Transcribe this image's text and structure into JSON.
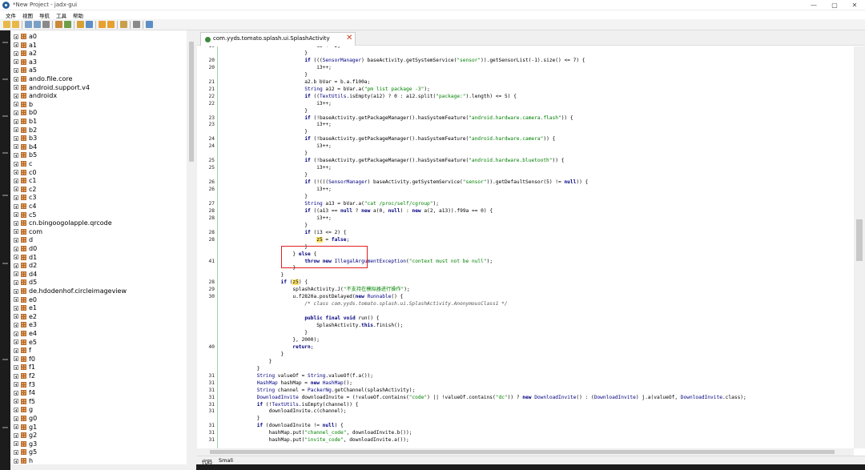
{
  "window": {
    "title": "*New Project - jadx-gui",
    "controls": {
      "minimize": "—",
      "maximize": "▢",
      "close": "✕"
    }
  },
  "menubar": [
    "文件",
    "视图",
    "导航",
    "工具",
    "帮助"
  ],
  "tree": {
    "items": [
      "a0",
      "a1",
      "a2",
      "a3",
      "a5",
      "ando.file.core",
      "android.support.v4",
      "androidx",
      "b",
      "b0",
      "b1",
      "b2",
      "b3",
      "b4",
      "b5",
      "c",
      "c0",
      "c1",
      "c2",
      "c3",
      "c4",
      "c5",
      "cn.bingoogolapple.qrcode",
      "com",
      "d",
      "d0",
      "d1",
      "d2",
      "d4",
      "d5",
      "de.hdodenhof.circleimageview",
      "e0",
      "e1",
      "e2",
      "e3",
      "e4",
      "e5",
      "f",
      "f0",
      "f1",
      "f2",
      "f3",
      "f4",
      "f5",
      "g",
      "g0",
      "g1",
      "g2",
      "g3",
      "g5",
      "h"
    ]
  },
  "editor": {
    "tab_label": "com.yyds.tomato.splash.ui.SplashActivity",
    "close_glyph": "✕",
    "bottom_tabs": [
      "代码",
      "Smali"
    ]
  },
  "code": {
    "lines": [
      {
        "n": "19",
        "t": "                                i3 += 2;"
      },
      {
        "n": "",
        "t": "                            }"
      },
      {
        "n": "20",
        "t": "                            if (((SensorManager) baseActivity.getSystemService(\"sensor\")).getSensorList(-1).size() <= 7) {"
      },
      {
        "n": "20",
        "t": "                                i3++;"
      },
      {
        "n": "",
        "t": "                            }"
      },
      {
        "n": "21",
        "t": "                            a2.b bVar = b.a.f100a;"
      },
      {
        "n": "21",
        "t": "                            String a12 = bVar.a(\"pm list package -3\");"
      },
      {
        "n": "22",
        "t": "                            if ((TextUtils.isEmpty(a12) ? 0 : a12.split(\"package:\").length) <= 5) {"
      },
      {
        "n": "22",
        "t": "                                i3++;"
      },
      {
        "n": "",
        "t": "                            }"
      },
      {
        "n": "23",
        "t": "                            if (!baseActivity.getPackageManager().hasSystemFeature(\"android.hardware.camera.flash\")) {"
      },
      {
        "n": "23",
        "t": "                                i3++;"
      },
      {
        "n": "",
        "t": "                            }"
      },
      {
        "n": "24",
        "t": "                            if (!baseActivity.getPackageManager().hasSystemFeature(\"android.hardware.camera\")) {"
      },
      {
        "n": "24",
        "t": "                                i3++;"
      },
      {
        "n": "",
        "t": "                            }"
      },
      {
        "n": "25",
        "t": "                            if (!baseActivity.getPackageManager().hasSystemFeature(\"android.hardware.bluetooth\")) {"
      },
      {
        "n": "25",
        "t": "                                i3++;"
      },
      {
        "n": "",
        "t": "                            }"
      },
      {
        "n": "26",
        "t": "                            if (!(((SensorManager) baseActivity.getSystemService(\"sensor\")).getDefaultSensor(5) != null)) {"
      },
      {
        "n": "26",
        "t": "                                i3++;"
      },
      {
        "n": "",
        "t": "                            }"
      },
      {
        "n": "27",
        "t": "                            String a13 = bVar.a(\"cat /proc/self/cgroup\");"
      },
      {
        "n": "28",
        "t": "                            if ((a13 == null ? new a(0, null) : new a(2, a13)).f99a == 0) {"
      },
      {
        "n": "28",
        "t": "                                i3++;"
      },
      {
        "n": "",
        "t": "                            }"
      },
      {
        "n": "28",
        "t": "                            if (i3 <= 2) {"
      },
      {
        "n": "28",
        "t": "                                z5 = false;"
      },
      {
        "n": "",
        "t": "                            }"
      },
      {
        "n": "",
        "t": "                        } else {"
      },
      {
        "n": "41",
        "t": "                            throw new IllegalArgumentException(\"context must not be null\");"
      },
      {
        "n": "",
        "t": "                        }"
      },
      {
        "n": "",
        "t": "                    }"
      },
      {
        "n": "28",
        "t": "                    if (z5) {"
      },
      {
        "n": "29",
        "t": "                        splashActivity.J(\"不支持在模拟器进行操作\");"
      },
      {
        "n": "30",
        "t": "                        u.f2820a.postDelayed(new Runnable() {"
      },
      {
        "n": "",
        "t": "                            /* class com.yyds.tomato.splash.ui.SplashActivity.AnonymousClass1 */"
      },
      {
        "n": "",
        "t": ""
      },
      {
        "n": "",
        "t": "                            public final void run() {"
      },
      {
        "n": "",
        "t": "                                SplashActivity.this.finish();"
      },
      {
        "n": "",
        "t": "                            }"
      },
      {
        "n": "",
        "t": "                        }, 2000);"
      },
      {
        "n": "40",
        "t": "                        return;"
      },
      {
        "n": "",
        "t": "                    }"
      },
      {
        "n": "",
        "t": "                }"
      },
      {
        "n": "",
        "t": "            }"
      },
      {
        "n": "31",
        "t": "            String valueOf = String.valueOf(f.a());"
      },
      {
        "n": "31",
        "t": "            HashMap hashMap = new HashMap();"
      },
      {
        "n": "31",
        "t": "            String channel = PackerNg.getChannel(splashActivity);"
      },
      {
        "n": "31",
        "t": "            DownloadInvite downloadInvite = (!valueOf.contains(\"code\") || !valueOf.contains(\"dc\")) ? new DownloadInvite() : (DownloadInvite) j.a(valueOf, DownloadInvite.class);"
      },
      {
        "n": "31",
        "t": "            if (!TextUtils.isEmpty(channel)) {"
      },
      {
        "n": "31",
        "t": "                downloadInvite.c(channel);"
      },
      {
        "n": "",
        "t": "            }"
      },
      {
        "n": "31",
        "t": "            if (downloadInvite != null) {"
      },
      {
        "n": "31",
        "t": "                hashMap.put(\"channel_code\", downloadInvite.b());"
      },
      {
        "n": "31",
        "t": "                hashMap.put(\"invite_code\", downloadInvite.a());"
      }
    ]
  }
}
